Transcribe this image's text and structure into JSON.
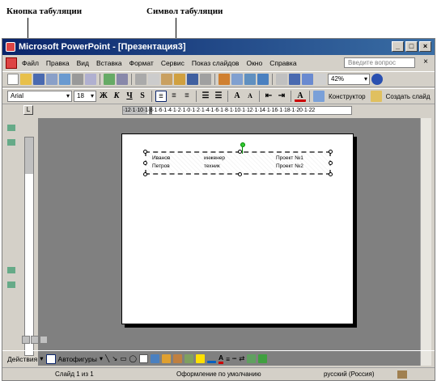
{
  "annotations": {
    "tab_button_label": "Кнопка табуляции",
    "tab_symbol_label": "Символ табуляции"
  },
  "window": {
    "title": "Microsoft PowerPoint - [Презентация3]",
    "min_btn": "_",
    "max_btn": "□",
    "close_btn": "×"
  },
  "menu": {
    "items": [
      "Файл",
      "Правка",
      "Вид",
      "Вставка",
      "Формат",
      "Сервис",
      "Показ слайдов",
      "Окно",
      "Справка"
    ],
    "help_placeholder": "Введите вопрос",
    "close": "×"
  },
  "toolbar_format": {
    "font": "Arial",
    "size": "18",
    "bold": "Ж",
    "italic": "К",
    "underline": "Ч",
    "shadow": "S",
    "zoom": "42%",
    "designer": "Конструктор",
    "new_slide": "Создать слайд"
  },
  "ruler": {
    "tab_button_glyph": "L",
    "ticks": "·12·1·10·1·8·1·6·1·4·1·2·1·0·1·2·1·4·1·6·1·8·1·10·1·12·1·14·1·16·1·18·1·20·1·22"
  },
  "slide": {
    "rows": [
      {
        "name": "Иванов",
        "role": "инженер",
        "project": "Проект №1"
      },
      {
        "name": "Петров",
        "role": "техник",
        "project": "Проект №2"
      }
    ]
  },
  "drawing_bar": {
    "actions": "Действия",
    "autoshapes": "Автофигуры"
  },
  "status": {
    "slide": "Слайд 1 из 1",
    "design": "Оформление по умолчанию",
    "language": "русский (Россия)"
  }
}
